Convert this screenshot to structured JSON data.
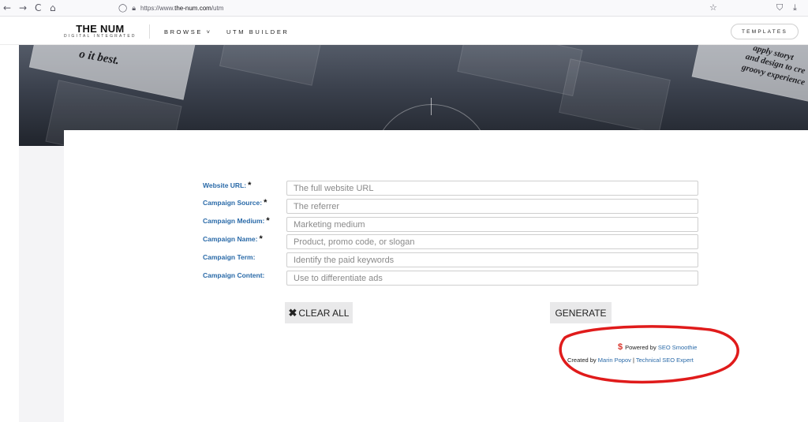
{
  "browser": {
    "back": "←",
    "forward": "→",
    "reload": "C",
    "home": "⌂",
    "url_prefix": "https://www.",
    "url_host": "the-num.com",
    "url_path": "/utm",
    "star": "☆",
    "shield": "⛉",
    "download": "⤓"
  },
  "header": {
    "logo_main": "THE NUM",
    "logo_sub": "DIGITAL INTEGRATED",
    "nav": [
      {
        "label": "BROWSE"
      },
      {
        "label": "UTM BUILDER"
      }
    ],
    "browse_chevron": "˅",
    "templates_label": "TEMPLATES"
  },
  "hero": {
    "text_left": "o it best.",
    "text_right_1": "apply storyt",
    "text_right_2": "and design to cre",
    "text_right_3": "groovy experience"
  },
  "form": {
    "required_mark": "*",
    "fields": [
      {
        "label": "Website URL:",
        "required": true,
        "placeholder": "The full website URL",
        "value": ""
      },
      {
        "label": "Campaign Source:",
        "required": true,
        "placeholder": "The referrer",
        "value": ""
      },
      {
        "label": "Campaign Medium:",
        "required": true,
        "placeholder": "Marketing medium",
        "value": ""
      },
      {
        "label": "Campaign Name:",
        "required": true,
        "placeholder": "Product, promo code, or slogan",
        "value": ""
      },
      {
        "label": "Campaign Term:",
        "required": false,
        "placeholder": "Identify the paid keywords",
        "value": ""
      },
      {
        "label": "Campaign Content:",
        "required": false,
        "placeholder": "Use to differentiate ads",
        "value": ""
      }
    ],
    "clear_icon": "✖",
    "clear_label": "CLEAR ALL",
    "generate_label": "GENERATE"
  },
  "credits": {
    "icon": "$",
    "powered_text": "Powered by ",
    "powered_link": "SEO Smoothie",
    "created_text": "Created by ",
    "author_link": "Marin Popov",
    "separator": " | ",
    "expert_link": "Technical SEO Expert"
  },
  "annotation": {
    "ellipse_color": "#e01b1b"
  }
}
